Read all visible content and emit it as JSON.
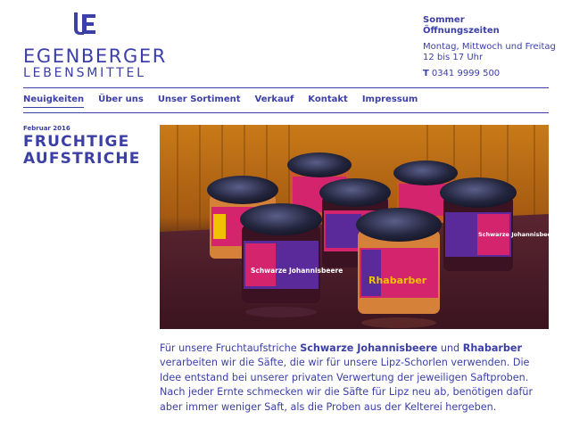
{
  "brand": {
    "name": "EGENBERGER",
    "subtitle": "LEBENSMITTEL",
    "logo_icon": "E-monogram-icon"
  },
  "hours": {
    "title_line1": "Sommer",
    "title_line2": "Öffnungszeiten",
    "days": "Montag, Mittwoch und Freitag",
    "time": "12 bis 17 Uhr",
    "phone_prefix": "T",
    "phone": "0341 9999 500"
  },
  "nav": {
    "items": [
      {
        "label": "Neuigkeiten",
        "active": true
      },
      {
        "label": "Über uns",
        "active": false
      },
      {
        "label": "Unser Sortiment",
        "active": false
      },
      {
        "label": "Verkauf",
        "active": false
      },
      {
        "label": "Kontakt",
        "active": false
      },
      {
        "label": "Impressum",
        "active": false
      }
    ]
  },
  "post": {
    "date": "Februar 2016",
    "title": "FRUCHTIGE AUFSTRICHE",
    "photo": {
      "label_left": "Schwarze Johannisbeere",
      "label_center": "Rhabarber",
      "label_right": "Schwarze Johannisbeere"
    },
    "text": {
      "p1_a": "Für unsere Fruchtaufstriche ",
      "p1_b": "Schwarze Johannisbeere",
      "p1_c": " und ",
      "p1_d": "Rhabarber",
      "p1_e": " verarbeiten wir die Säfte, die wir für unsere Lipz-Schorlen verwenden. Die Idee entstand bei unserer privaten Verwertung der jeweiligen Saftproben. Nach jeder Ernte schmecken wir die Säfte für Lipz neu ab, benötigen dafür aber immer weniger Saft, als die Proben aus der Kelterei hergeben."
    }
  },
  "colors": {
    "brand_blue": "#3b3fa6",
    "label_magenta": "#d4246e",
    "label_purple": "#5a2a9a",
    "label_yellow": "#f2c200",
    "background": "#ffffff"
  }
}
